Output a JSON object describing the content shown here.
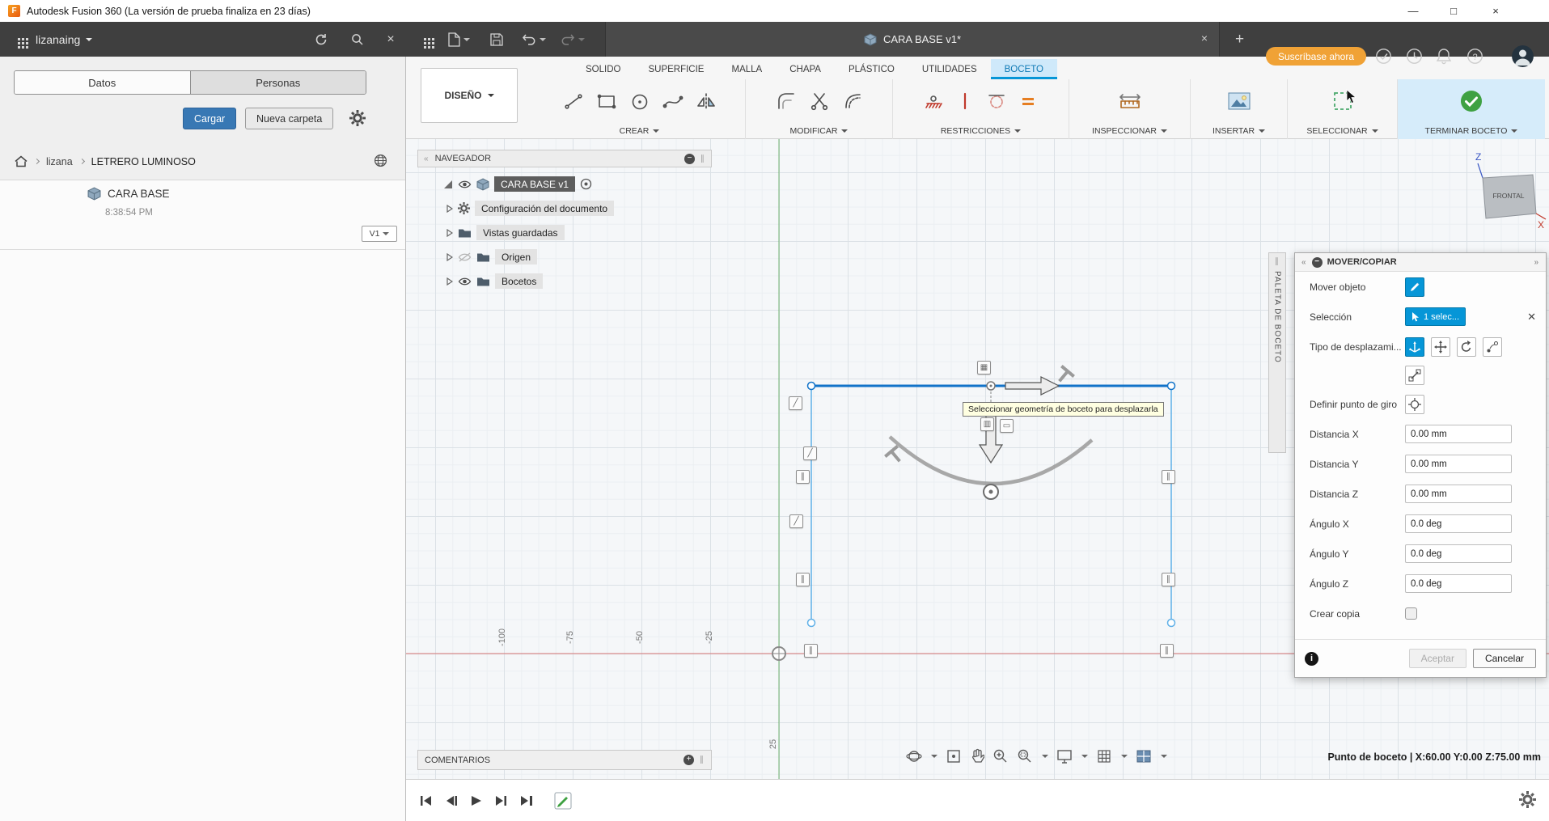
{
  "titlebar": {
    "title": "Autodesk Fusion 360 (La versión de prueba finaliza en 23 días)",
    "window_controls": {
      "minimize": "—",
      "maximize": "□",
      "close": "×"
    }
  },
  "appbar": {
    "user": "lizanaing",
    "document_tab": "CARA BASE v1*",
    "subscribe_label": "Suscríbase ahora"
  },
  "data_panel": {
    "tabs": {
      "datos": "Datos",
      "personas": "Personas"
    },
    "upload_label": "Cargar",
    "new_folder_label": "Nueva carpeta",
    "breadcrumb": {
      "root": "lizana",
      "project": "LETRERO LUMINOSO"
    },
    "item": {
      "name": "CARA BASE",
      "time": "8:38:54 PM",
      "version": "V1"
    }
  },
  "ribbon": {
    "design_label": "DISEÑO",
    "tabs": [
      "SOLIDO",
      "SUPERFICIE",
      "MALLA",
      "CHAPA",
      "PLÁSTICO",
      "UTILIDADES",
      "BOCETO"
    ],
    "groups": {
      "crear": "CREAR",
      "modificar": "MODIFICAR",
      "restricciones": "RESTRICCIONES",
      "inspeccionar": "INSPECCIONAR",
      "insertar": "INSERTAR",
      "seleccionar": "SELECCIONAR",
      "terminar": "TERMINAR BOCETO"
    }
  },
  "navigator": {
    "title": "NAVEGADOR",
    "root_label": "CARA BASE v1",
    "items": [
      "Configuración del documento",
      "Vistas guardadas",
      "Origen",
      "Bocetos"
    ]
  },
  "viewport": {
    "tooltip": "Seleccionar geometría de boceto para desplazarla",
    "ruler_labels": [
      "-100",
      "-75",
      "-50",
      "-25",
      "25"
    ],
    "viewcube": {
      "front_label": "FRONTAL",
      "z_label": "Z",
      "x_label": "X"
    }
  },
  "sketch_palette_strip": "PALETA DE BOCETO",
  "move_dialog": {
    "title": "MOVER/COPIAR",
    "labels": {
      "move_object": "Mover objeto",
      "selection": "Selección",
      "selection_chip": "1 selec...",
      "move_type": "Tipo de desplazami...",
      "pivot": "Definir punto de giro",
      "dist_x": "Distancia X",
      "dist_y": "Distancia Y",
      "dist_z": "Distancia Z",
      "ang_x": "Ángulo X",
      "ang_y": "Ángulo Y",
      "ang_z": "Ángulo Z",
      "copy": "Crear copia"
    },
    "values": {
      "dist_x": "0.00 mm",
      "dist_y": "0.00 mm",
      "dist_z": "0.00 mm",
      "ang_x": "0.0 deg",
      "ang_y": "0.0 deg",
      "ang_z": "0.0 deg"
    },
    "accept_label": "Aceptar",
    "cancel_label": "Cancelar"
  },
  "comments": {
    "title": "COMENTARIOS"
  },
  "status": {
    "sketch_point": "Punto de boceto | X:60.00 Y:0.00 Z:75.00 mm"
  },
  "colors": {
    "accent_blue": "#0696d7",
    "subscribe_orange": "#f0a236",
    "finish_green": "#3fa142",
    "axis_red": "#d34f4f",
    "axis_green": "#56a556"
  }
}
